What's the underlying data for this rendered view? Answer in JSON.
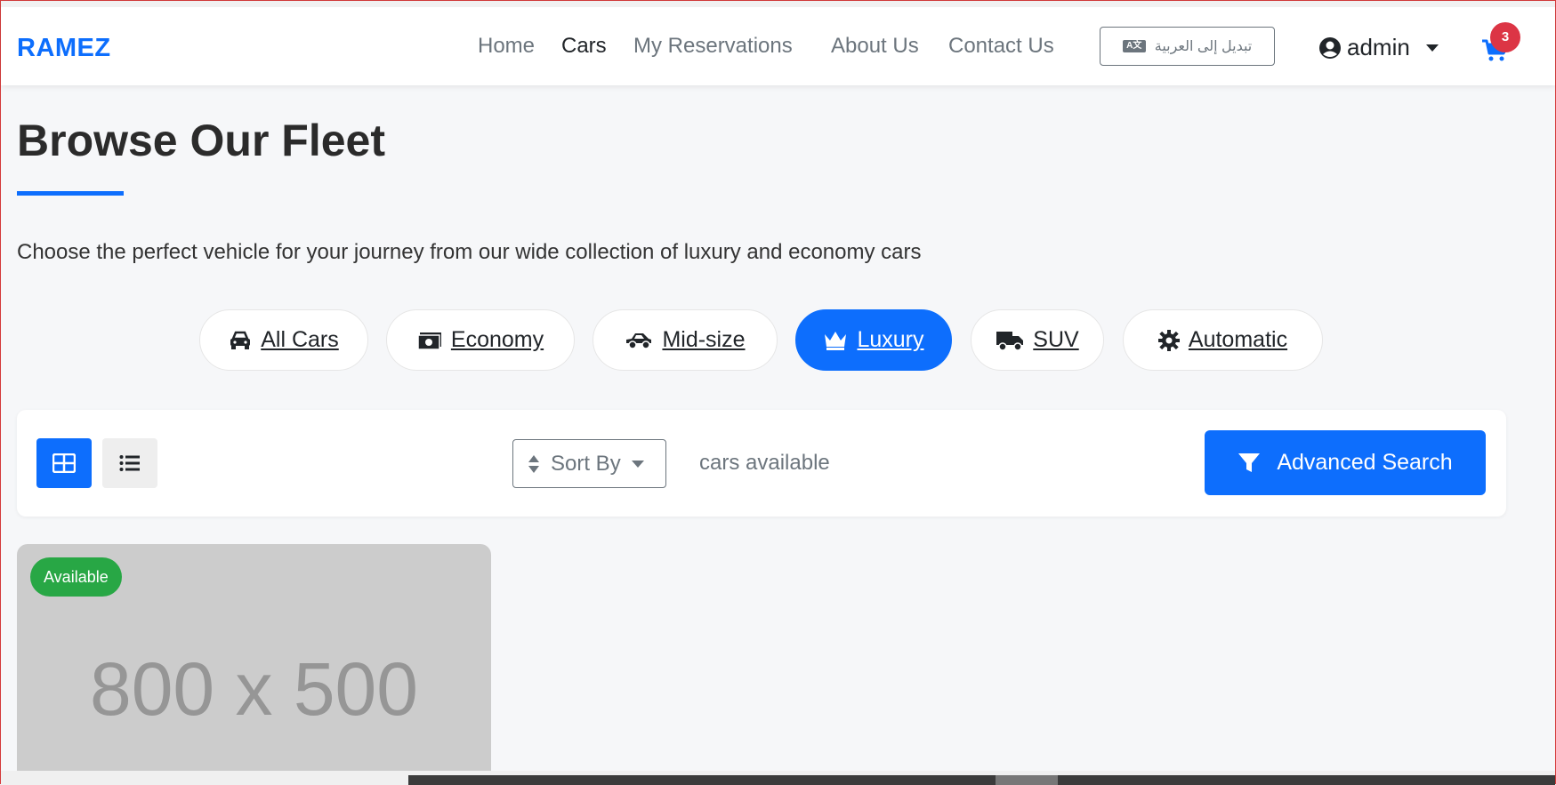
{
  "header": {
    "brand": "RAMEZ",
    "nav": [
      {
        "label": "Home",
        "active": false
      },
      {
        "label": "Cars",
        "active": true
      },
      {
        "label": "My Reservations",
        "active": false
      },
      {
        "label": "About Us",
        "active": false
      },
      {
        "label": "Contact Us",
        "active": false
      }
    ],
    "language_button": "تبديل إلى العربية",
    "user": "admin",
    "cart_count": "3"
  },
  "main": {
    "title": "Browse Our Fleet",
    "subtitle": "Choose the perfect vehicle for your journey from our wide collection of luxury and economy cars",
    "filters": [
      {
        "label": "All Cars",
        "icon": "car-icon",
        "active": false
      },
      {
        "label": "Economy",
        "icon": "money-icon",
        "active": false
      },
      {
        "label": "Mid-size",
        "icon": "car-side-icon",
        "active": false
      },
      {
        "label": "Luxury",
        "icon": "crown-icon",
        "active": true
      },
      {
        "label": "SUV",
        "icon": "truck-icon",
        "active": false
      },
      {
        "label": "Automatic",
        "icon": "gear-icon",
        "active": false
      }
    ]
  },
  "toolbar": {
    "sort_label": "Sort By",
    "count_text": "cars available",
    "advanced_search": "Advanced Search",
    "active_view": "grid"
  },
  "cards": [
    {
      "badge": "Available",
      "image_placeholder": "800 x 500"
    }
  ],
  "colors": {
    "primary": "#0d6efd",
    "success": "#28a745",
    "danger": "#dc3545",
    "muted": "#6c757d"
  }
}
